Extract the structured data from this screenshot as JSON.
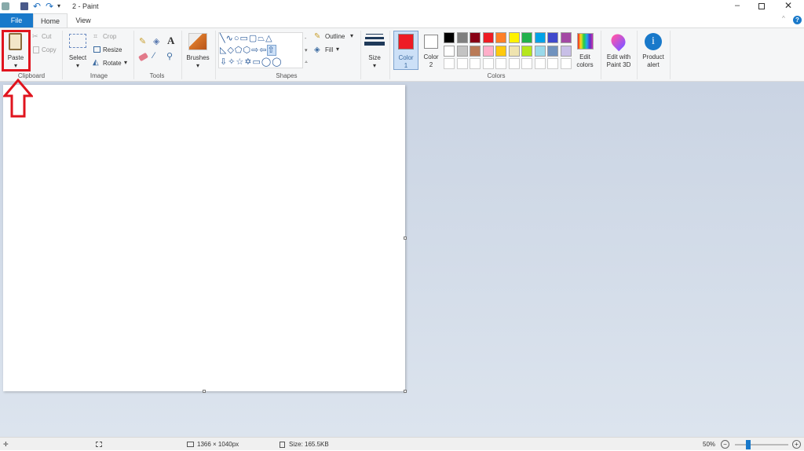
{
  "window": {
    "title": "2 - Paint"
  },
  "tabs": [
    {
      "label": "File"
    },
    {
      "label": "Home"
    },
    {
      "label": "View"
    }
  ],
  "clipboard": {
    "group": "Clipboard",
    "paste": "Paste",
    "cut": "Cut",
    "copy": "Copy"
  },
  "image": {
    "group": "Image",
    "select": "Select",
    "crop": "Crop",
    "resize": "Resize",
    "rotate": "Rotate"
  },
  "tools": {
    "group": "Tools"
  },
  "brushes": {
    "label": "Brushes"
  },
  "shapes": {
    "group": "Shapes",
    "outline": "Outline",
    "fill": "Fill"
  },
  "size": {
    "label": "Size"
  },
  "colors": {
    "group": "Colors",
    "color1_a": "Color",
    "color1_b": "1",
    "color2_a": "Color",
    "color2_b": "2",
    "edit_a": "Edit",
    "edit_b": "colors",
    "color1": "#ed1c24",
    "color2": "#ffffff",
    "palette_row1": [
      "#000000",
      "#7f7f7f",
      "#880015",
      "#ed1c24",
      "#ff7f27",
      "#fff200",
      "#22b14c",
      "#00a2e8",
      "#3f48cc",
      "#a349a4"
    ],
    "palette_row2": [
      "#ffffff",
      "#c3c3c3",
      "#b97a57",
      "#ffaec9",
      "#ffc90e",
      "#efe4b0",
      "#b5e61d",
      "#99d9ea",
      "#7092be",
      "#c8bfe7"
    ]
  },
  "paint3d": {
    "a": "Edit with",
    "b": "Paint 3D"
  },
  "alert": {
    "a": "Product",
    "b": "alert"
  },
  "status": {
    "dimensions": "1366 × 1040px",
    "size": "Size: 165.5KB",
    "zoom": "50%"
  },
  "annotation_color": "#e0141e"
}
